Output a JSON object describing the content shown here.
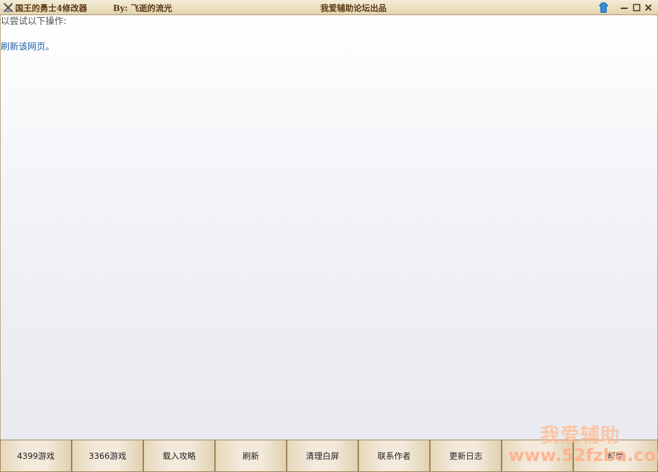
{
  "titlebar": {
    "app_title": "国王的勇士4修改器",
    "author": "By: 飞逝的流光",
    "center_title": "我爱辅助论坛出品"
  },
  "content": {
    "line1": "以尝试以下操作:",
    "link": "刷新该网页。"
  },
  "buttons": [
    "4399游戏",
    "3366游戏",
    "载入攻略",
    "刷新",
    "清理白屏",
    "联系作者",
    "更新日志",
    "",
    "",
    "帮助"
  ],
  "watermark": {
    "line1": "我爱辅助",
    "line2": "www.52fzba.com"
  },
  "colors": {
    "titlebar": "#e3d4b0",
    "title_text": "#5a3a14",
    "link": "#1f5fa8",
    "watermark": "#ffbe96"
  },
  "icons": [
    "app-icon",
    "skin-icon",
    "minimize-icon",
    "maximize-icon",
    "close-icon"
  ]
}
